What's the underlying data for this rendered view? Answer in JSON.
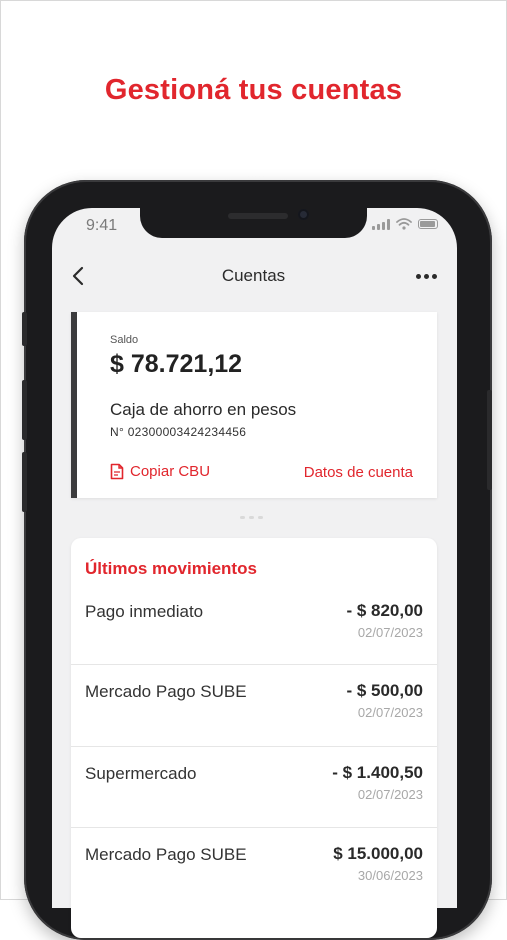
{
  "headline": "Gestioná tus cuentas",
  "status_bar": {
    "time": "9:41"
  },
  "nav": {
    "title": "Cuentas"
  },
  "account": {
    "saldo_label": "Saldo",
    "saldo_value": "$ 78.721,12",
    "name": "Caja de ahorro en pesos",
    "number": "N° 02300003424234456",
    "copy_cbu_label": "Copiar CBU",
    "details_label": "Datos de cuenta"
  },
  "movements": {
    "title": "Últimos movimientos",
    "items": [
      {
        "description": "Pago inmediato",
        "amount": "- $ 820,00",
        "date": "02/07/2023"
      },
      {
        "description": "Mercado Pago SUBE",
        "amount": "- $ 500,00",
        "date": "02/07/2023"
      },
      {
        "description": "Supermercado",
        "amount": "- $ 1.400,50",
        "date": "02/07/2023"
      },
      {
        "description": "Mercado Pago SUBE",
        "amount": "$ 15.000,00",
        "date": "30/06/2023"
      }
    ]
  },
  "colors": {
    "accent": "#e1262d",
    "card_border": "#3b3b3d",
    "screen_bg": "#f1f1f2"
  },
  "icons": {
    "back": "chevron-left-icon",
    "more": "more-horizontal-icon",
    "copy": "document-icon"
  }
}
